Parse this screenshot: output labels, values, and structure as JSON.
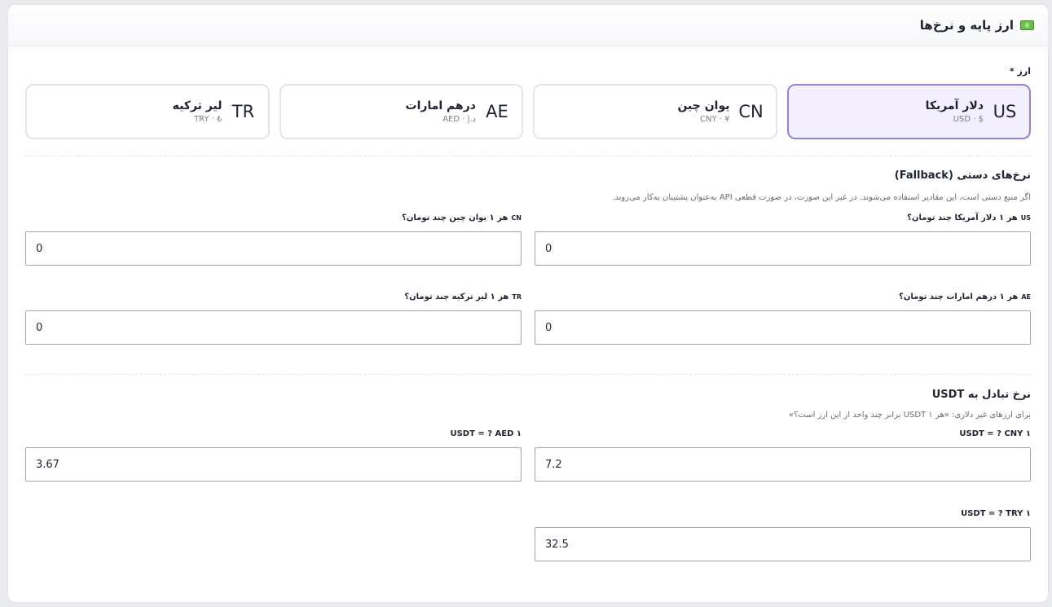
{
  "header": {
    "title": "ارز پایه و نرخ‌ها",
    "icon": "money-icon"
  },
  "currency_section": {
    "label": "ارز *",
    "options": [
      {
        "code": "US",
        "name": "دلار آمریکا",
        "sub": "$ · USD",
        "selected": true
      },
      {
        "code": "CN",
        "name": "یوان چین",
        "sub": "¥ · CNY",
        "selected": false
      },
      {
        "code": "AE",
        "name": "درهم امارات",
        "sub": "د.إ · AED",
        "selected": false
      },
      {
        "code": "TR",
        "name": "لیر ترکیه",
        "sub": "₺ · TRY",
        "selected": false
      }
    ]
  },
  "fallback_section": {
    "title": "نرخ‌های دستی (Fallback)",
    "hint": "اگر منبع دستی است، این مقادیر استفاده می‌شوند. در غیر این صورت، در صورت قطعی API به‌عنوان پشتیبان به‌کار می‌روند.",
    "fields": [
      {
        "tag": "US",
        "label": "هر ۱ دلار آمریکا چند تومان؟",
        "value": "0"
      },
      {
        "tag": "CN",
        "label": "هر ۱ یوان چین چند تومان؟",
        "value": "0"
      },
      {
        "tag": "AE",
        "label": "هر ۱ درهم امارات چند تومان؟",
        "value": "0"
      },
      {
        "tag": "TR",
        "label": "هر ۱ لیر ترکیه چند تومان؟",
        "value": "0"
      }
    ]
  },
  "usdt_section": {
    "title": "نرخ تبادل به USDT",
    "hint": "برای ارزهای غیر دلاری: «هر ۱ USDT برابر چند واحد از این ارز است؟»",
    "fields": [
      {
        "label": "۱ USDT = ? CNY",
        "value": "7.2"
      },
      {
        "label": "۱ USDT = ? AED",
        "value": "3.67"
      },
      {
        "label": "۱ USDT = ? TRY",
        "value": "32.5"
      }
    ]
  },
  "colors": {
    "accent": "#8b84e6",
    "selected_bg": "#f4efff",
    "border": "#e3e5ea"
  }
}
